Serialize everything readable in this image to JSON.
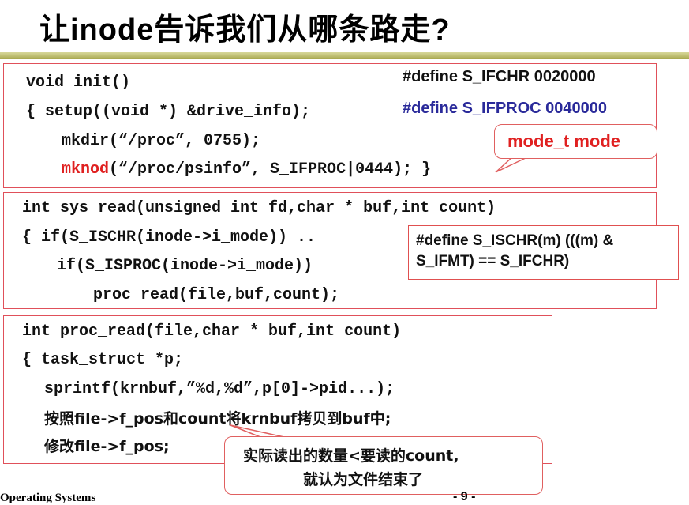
{
  "slide": {
    "title": "让inode告诉我们从哪条路走?"
  },
  "box1": {
    "line1": "void init()",
    "line2": "{   setup((void *) &drive_info);",
    "line3": "mkdir(“/proc”, 0755);",
    "line4_fn": "mknod",
    "line4_rest": "(“/proc/psinfo”, S_IFPROC|0444);",
    "define1": "#define S_IFCHR  0020000",
    "define2": "#define S_IFPROC  0040000",
    "callout": "mode_t  mode"
  },
  "box2": {
    "line1": "int sys_read(unsigned int fd,char * buf,int count)",
    "line2": "{   if(S_ISCHR(inode->i_mode)) ..",
    "line3": "if(S_ISPROC(inode->i_mode))",
    "line4": "proc_read(file,buf,count);",
    "define_line1": "#define S_ISCHR(m)   (((m) &",
    "define_line2": "S_IFMT) == S_IFCHR)"
  },
  "box3": {
    "line1": "int proc_read(file,char * buf,int count)",
    "line2": "{ task_struct *p;",
    "line3": "sprintf(krnbuf,”%d,%d”,p[0]->pid...);",
    "line4": "按照file->f_pos和count将krnbuf拷贝到buf中;",
    "line5": "修改file->f_pos;",
    "callout_line1": "实际读出的数量<要读的count,",
    "callout_line2": "就认为文件结束了"
  },
  "footer": {
    "course": "Operating Systems",
    "page": "- 9 -"
  },
  "colors": {
    "border": "#e0505a",
    "red_text": "#e02020",
    "blue_text": "#2a2a9a",
    "title_bar": "#b8b860"
  }
}
